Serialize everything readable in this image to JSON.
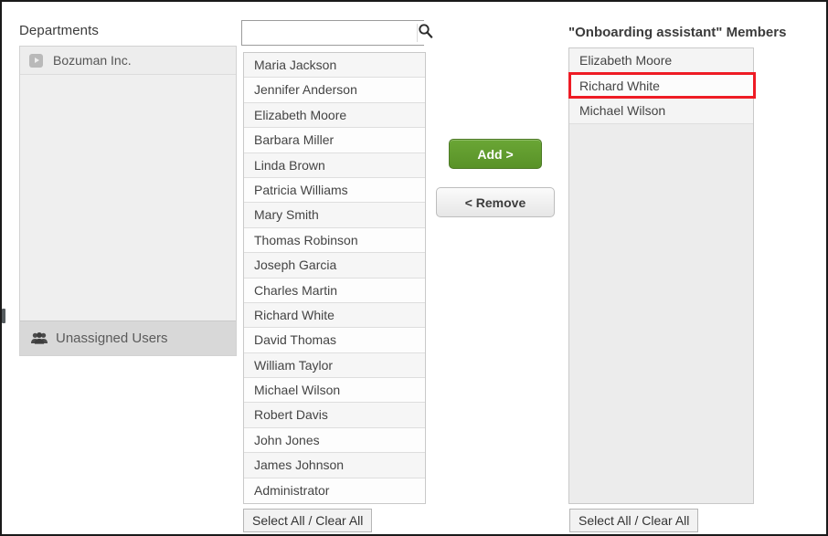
{
  "departments": {
    "title": "Departments",
    "root": {
      "label": "Bozuman Inc.",
      "icon": "expand-triangle-icon"
    },
    "unassigned": {
      "label": "Unassigned Users",
      "icon": "group-users-icon"
    }
  },
  "search": {
    "value": "",
    "placeholder": "",
    "icon": "search-icon"
  },
  "candidates": {
    "items": [
      "Maria Jackson",
      "Jennifer Anderson",
      "Elizabeth Moore",
      "Barbara Miller",
      "Linda Brown",
      "Patricia Williams",
      "Mary Smith",
      "Thomas Robinson",
      "Joseph Garcia",
      "Charles Martin",
      "Richard White",
      "David Thomas",
      "William Taylor",
      "Michael Wilson",
      "Robert Davis",
      "John Jones",
      "James Johnson",
      "Administrator"
    ],
    "select_all_label": "Select All / Clear All"
  },
  "transfer": {
    "add_label": "Add >",
    "remove_label": "< Remove",
    "add_color": "#5f9d2e",
    "remove_color": "#e9e9e9"
  },
  "members": {
    "title": "\"Onboarding assistant\" Members",
    "items": [
      "Elizabeth Moore",
      "Richard White",
      "Michael Wilson"
    ],
    "select_all_label": "Select All / Clear All",
    "highlighted_item": "Richard White",
    "highlight_color": "#ee1c25"
  }
}
